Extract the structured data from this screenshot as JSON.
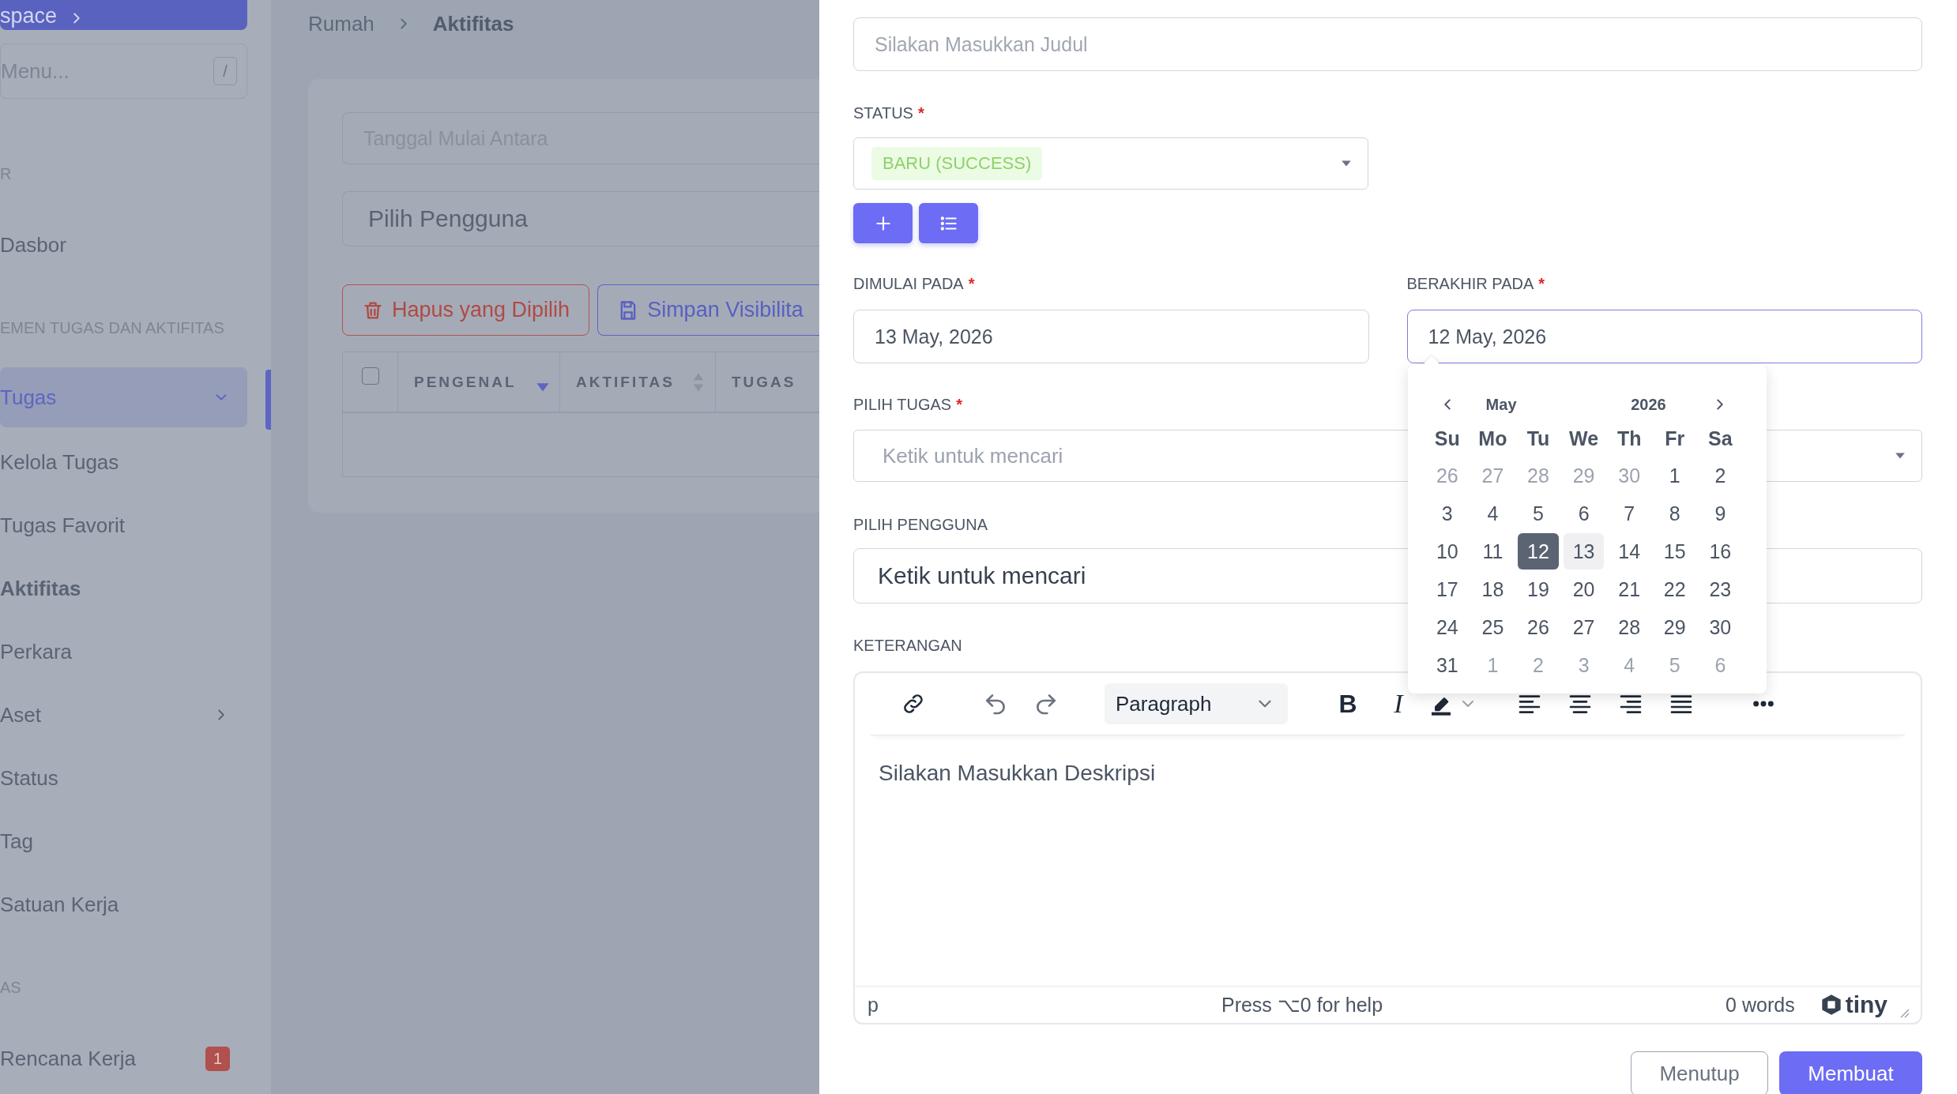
{
  "sidebar": {
    "workspace_button": "space",
    "menu_search": {
      "placeholder": "Menu...",
      "shortcut": "/"
    },
    "entries": [
      {
        "kind": "section",
        "label": "R"
      },
      {
        "kind": "item",
        "label": "Dasbor",
        "selected": false,
        "current": false
      },
      {
        "kind": "section",
        "label": "EMEN TUGAS DAN AKTIFITAS"
      },
      {
        "kind": "group",
        "label": "Tugas",
        "selected": true,
        "current": false,
        "expanded": true
      },
      {
        "kind": "item",
        "label": "Kelola Tugas",
        "selected": false,
        "current": false
      },
      {
        "kind": "item",
        "label": "Tugas Favorit",
        "selected": false,
        "current": false
      },
      {
        "kind": "item",
        "label": "Aktifitas",
        "selected": false,
        "current": true
      },
      {
        "kind": "item",
        "label": "Perkara",
        "selected": false,
        "current": false
      },
      {
        "kind": "group",
        "label": "Aset",
        "selected": false,
        "current": false,
        "expanded": false
      },
      {
        "kind": "item",
        "label": "Status",
        "selected": false,
        "current": false
      },
      {
        "kind": "item",
        "label": "Tag",
        "selected": false,
        "current": false
      },
      {
        "kind": "item",
        "label": "Satuan Kerja",
        "selected": false,
        "current": false
      },
      {
        "kind": "section",
        "label": "AS"
      },
      {
        "kind": "item",
        "label": "Rencana Kerja",
        "selected": false,
        "current": false,
        "badge": "1"
      }
    ]
  },
  "breadcrumb": [
    "Rumah",
    "Aktifitas"
  ],
  "filters": {
    "date_range": {
      "placeholder": "Tanggal Mulai Antara"
    },
    "user": {
      "placeholder": "Pilih Pengguna"
    }
  },
  "actions": [
    {
      "kind": "delete",
      "label": "Hapus yang Dipilih"
    },
    {
      "kind": "save",
      "label": "Simpan Visibilita"
    }
  ],
  "table": {
    "select_all": {
      "checked": false
    },
    "columns": [
      {
        "label": "PENGENAL",
        "sortable": true,
        "sorted": true
      },
      {
        "label": "AKTIFITAS",
        "sortable": true,
        "sorted": false
      },
      {
        "label": "TUGAS"
      }
    ]
  },
  "form": {
    "title": {
      "placeholder": "Silakan Masukkan Judul"
    },
    "status": {
      "label": "STATUS",
      "mark": "*",
      "value": "BARU (SUCCESS)"
    },
    "status_buttons": [
      {
        "kind": "add"
      },
      {
        "kind": "list"
      }
    ],
    "start": {
      "label": "DIMULAI PADA",
      "mark": "*",
      "value": "13 May, 2026",
      "focused": false
    },
    "end": {
      "label": "BERAKHIR PADA",
      "mark": "*",
      "value": "12 May, 2026",
      "focused": true
    },
    "task": {
      "label": "PILIH TUGAS",
      "mark": "*",
      "placeholder": "Ketik untuk mencari"
    },
    "user": {
      "label": "PILIH PENGGUNA",
      "placeholder": "Ketik untuk mencari"
    },
    "description": {
      "label": "KETERANGAN",
      "toolbar": [
        {
          "kind": "link"
        },
        {
          "kind": "undo"
        },
        {
          "kind": "redo"
        },
        {
          "kind": "format",
          "label": "Paragraph"
        },
        {
          "kind": "bold",
          "label": "B"
        },
        {
          "kind": "italic",
          "label": "I"
        },
        {
          "kind": "highlight"
        },
        {
          "kind": "align-left"
        },
        {
          "kind": "align-center"
        },
        {
          "kind": "align-right"
        },
        {
          "kind": "justify"
        },
        {
          "kind": "more"
        }
      ],
      "placeholder": "Silakan Masukkan Deskripsi",
      "path": "p",
      "help": "Press ⌥0 for help",
      "word_count": "0 words",
      "brand": "tiny"
    },
    "buttons": [
      {
        "kind": "secondary",
        "label": "Menutup"
      },
      {
        "kind": "primary",
        "label": "Membuat"
      }
    ]
  },
  "datepicker": {
    "month": "May",
    "year": "2026",
    "weekdays": [
      "Su",
      "Mo",
      "Tu",
      "We",
      "Th",
      "Fr",
      "Sa"
    ],
    "weeks": [
      [
        {
          "day": "26",
          "muted": true,
          "selected": false,
          "marked": false
        },
        {
          "day": "27",
          "muted": true,
          "selected": false,
          "marked": false
        },
        {
          "day": "28",
          "muted": true,
          "selected": false,
          "marked": false
        },
        {
          "day": "29",
          "muted": true,
          "selected": false,
          "marked": false
        },
        {
          "day": "30",
          "muted": true,
          "selected": false,
          "marked": false
        },
        {
          "day": "1",
          "muted": false,
          "selected": false,
          "marked": false
        },
        {
          "day": "2",
          "muted": false,
          "selected": false,
          "marked": false
        }
      ],
      [
        {
          "day": "3",
          "muted": false,
          "selected": false,
          "marked": false
        },
        {
          "day": "4",
          "muted": false,
          "selected": false,
          "marked": false
        },
        {
          "day": "5",
          "muted": false,
          "selected": false,
          "marked": false
        },
        {
          "day": "6",
          "muted": false,
          "selected": false,
          "marked": false
        },
        {
          "day": "7",
          "muted": false,
          "selected": false,
          "marked": false
        },
        {
          "day": "8",
          "muted": false,
          "selected": false,
          "marked": false
        },
        {
          "day": "9",
          "muted": false,
          "selected": false,
          "marked": false
        }
      ],
      [
        {
          "day": "10",
          "muted": false,
          "selected": false,
          "marked": false
        },
        {
          "day": "11",
          "muted": false,
          "selected": false,
          "marked": false
        },
        {
          "day": "12",
          "muted": false,
          "selected": true,
          "marked": false
        },
        {
          "day": "13",
          "muted": false,
          "selected": false,
          "marked": true
        },
        {
          "day": "14",
          "muted": false,
          "selected": false,
          "marked": false
        },
        {
          "day": "15",
          "muted": false,
          "selected": false,
          "marked": false
        },
        {
          "day": "16",
          "muted": false,
          "selected": false,
          "marked": false
        }
      ],
      [
        {
          "day": "17",
          "muted": false,
          "selected": false,
          "marked": false
        },
        {
          "day": "18",
          "muted": false,
          "selected": false,
          "marked": false
        },
        {
          "day": "19",
          "muted": false,
          "selected": false,
          "marked": false
        },
        {
          "day": "20",
          "muted": false,
          "selected": false,
          "marked": false
        },
        {
          "day": "21",
          "muted": false,
          "selected": false,
          "marked": false
        },
        {
          "day": "22",
          "muted": false,
          "selected": false,
          "marked": false
        },
        {
          "day": "23",
          "muted": false,
          "selected": false,
          "marked": false
        }
      ],
      [
        {
          "day": "24",
          "muted": false,
          "selected": false,
          "marked": false
        },
        {
          "day": "25",
          "muted": false,
          "selected": false,
          "marked": false
        },
        {
          "day": "26",
          "muted": false,
          "selected": false,
          "marked": false
        },
        {
          "day": "27",
          "muted": false,
          "selected": false,
          "marked": false
        },
        {
          "day": "28",
          "muted": false,
          "selected": false,
          "marked": false
        },
        {
          "day": "29",
          "muted": false,
          "selected": false,
          "marked": false
        },
        {
          "day": "30",
          "muted": false,
          "selected": false,
          "marked": false
        }
      ],
      [
        {
          "day": "31",
          "muted": false,
          "selected": false,
          "marked": false
        },
        {
          "day": "1",
          "muted": true,
          "selected": false,
          "marked": false
        },
        {
          "day": "2",
          "muted": true,
          "selected": false,
          "marked": false
        },
        {
          "day": "3",
          "muted": true,
          "selected": false,
          "marked": false
        },
        {
          "day": "4",
          "muted": true,
          "selected": false,
          "marked": false
        },
        {
          "day": "5",
          "muted": true,
          "selected": false,
          "marked": false
        },
        {
          "day": "6",
          "muted": true,
          "selected": false,
          "marked": false
        }
      ]
    ]
  }
}
